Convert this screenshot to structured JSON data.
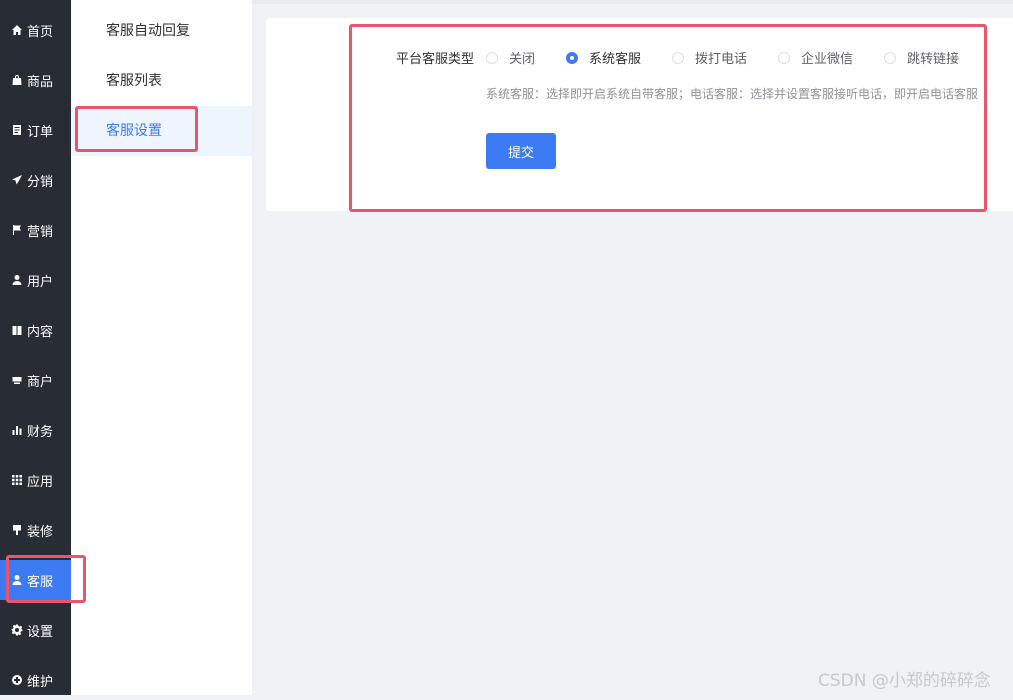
{
  "nav": {
    "items": [
      {
        "label": "首页",
        "icon": "home-icon"
      },
      {
        "label": "商品",
        "icon": "bag-icon"
      },
      {
        "label": "订单",
        "icon": "document-icon"
      },
      {
        "label": "分销",
        "icon": "send-icon"
      },
      {
        "label": "营销",
        "icon": "flag-icon"
      },
      {
        "label": "用户",
        "icon": "user-icon"
      },
      {
        "label": "内容",
        "icon": "book-icon"
      },
      {
        "label": "商户",
        "icon": "store-icon"
      },
      {
        "label": "财务",
        "icon": "bar-chart-icon"
      },
      {
        "label": "应用",
        "icon": "grid-icon"
      },
      {
        "label": "装修",
        "icon": "brush-icon"
      },
      {
        "label": "客服",
        "icon": "user-icon",
        "active": true
      },
      {
        "label": "设置",
        "icon": "gear-icon"
      },
      {
        "label": "维护",
        "icon": "tool-icon"
      }
    ]
  },
  "submenu": {
    "items": [
      {
        "label": "客服自动回复"
      },
      {
        "label": "客服列表"
      },
      {
        "label": "客服设置",
        "active": true
      }
    ]
  },
  "form": {
    "label": "平台客服类型",
    "options": [
      {
        "label": "关闭",
        "checked": false
      },
      {
        "label": "系统客服",
        "checked": true
      },
      {
        "label": "拨打电话",
        "checked": false
      },
      {
        "label": "企业微信",
        "checked": false
      },
      {
        "label": "跳转链接",
        "checked": false
      }
    ],
    "help": "系统客服：选择即开启系统自带客服；电话客服：选择并设置客服接听电话，即开启电话客服",
    "submit_label": "提交"
  },
  "colors": {
    "nav_bg": "#282c34",
    "accent": "#3d7bf4",
    "highlight": "#e8566b"
  },
  "watermark": "CSDN @小郑的碎碎念"
}
